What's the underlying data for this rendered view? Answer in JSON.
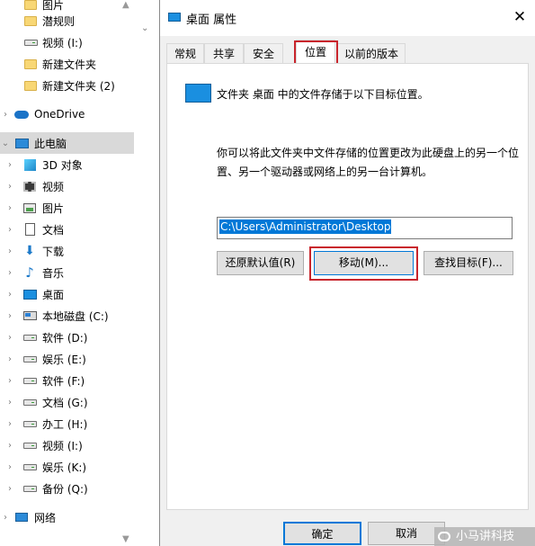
{
  "nav": {
    "items": [
      {
        "label": "图片",
        "icon": "folder-icon",
        "chevron": ""
      },
      {
        "label": "潜规则",
        "icon": "folder-icon",
        "chevron": ""
      },
      {
        "label": "视频 (I:)",
        "icon": "drive-icon",
        "chevron": ""
      },
      {
        "label": "新建文件夹",
        "icon": "folder-icon",
        "chevron": ""
      },
      {
        "label": "新建文件夹 (2)",
        "icon": "folder-icon",
        "chevron": ""
      },
      {
        "label": "OneDrive",
        "icon": "onedrive-cloud-icon",
        "chevron": "›"
      },
      {
        "label": "此电脑",
        "icon": "this-pc-icon",
        "chevron": "⌄"
      },
      {
        "label": "3D 对象",
        "icon": "3d-objects-icon",
        "chevron": "›"
      },
      {
        "label": "视频",
        "icon": "videos-icon",
        "chevron": "›"
      },
      {
        "label": "图片",
        "icon": "pictures-icon",
        "chevron": "›"
      },
      {
        "label": "文档",
        "icon": "documents-icon",
        "chevron": "›"
      },
      {
        "label": "下载",
        "icon": "downloads-icon",
        "chevron": "›"
      },
      {
        "label": "音乐",
        "icon": "music-icon",
        "chevron": "›"
      },
      {
        "label": "桌面",
        "icon": "desktop-icon",
        "chevron": "›"
      },
      {
        "label": "本地磁盘 (C:)",
        "icon": "system-drive-icon",
        "chevron": "›"
      },
      {
        "label": "软件 (D:)",
        "icon": "drive-icon",
        "chevron": "›"
      },
      {
        "label": "娱乐 (E:)",
        "icon": "drive-icon",
        "chevron": "›"
      },
      {
        "label": "软件 (F:)",
        "icon": "drive-icon",
        "chevron": "›"
      },
      {
        "label": "文档 (G:)",
        "icon": "drive-icon",
        "chevron": "›"
      },
      {
        "label": "办工 (H:)",
        "icon": "drive-icon",
        "chevron": "›"
      },
      {
        "label": "视频 (I:)",
        "icon": "drive-icon",
        "chevron": "›"
      },
      {
        "label": "娱乐 (K:)",
        "icon": "drive-icon",
        "chevron": "›"
      },
      {
        "label": "备份 (Q:)",
        "icon": "drive-icon",
        "chevron": "›"
      },
      {
        "label": "网络",
        "icon": "network-icon",
        "chevron": "›"
      }
    ]
  },
  "dialog": {
    "title": "桌面 属性",
    "close_glyph": "✕",
    "tabs": [
      "常规",
      "共享",
      "安全",
      "位置",
      "以前的版本"
    ],
    "active_tab": "位置",
    "intro": "文件夹 桌面 中的文件存储于以下目标位置。",
    "description": "你可以将此文件夹中文件存储的位置更改为此硬盘上的另一个位置、另一个驱动器或网络上的另一台计算机。",
    "path": "C:\\Users\\Administrator\\Desktop",
    "buttons": {
      "restore": "还原默认值(R)",
      "move": "移动(M)...",
      "find": "查找目标(F)..."
    },
    "footer": {
      "ok": "确定",
      "cancel": "取消"
    }
  },
  "watermark": "小马讲科技",
  "colors": {
    "accent": "#0078d7",
    "highlight": "#c8252c",
    "selected_nav": "#d9d9d9",
    "dialog_bg": "#f0f0f0"
  }
}
